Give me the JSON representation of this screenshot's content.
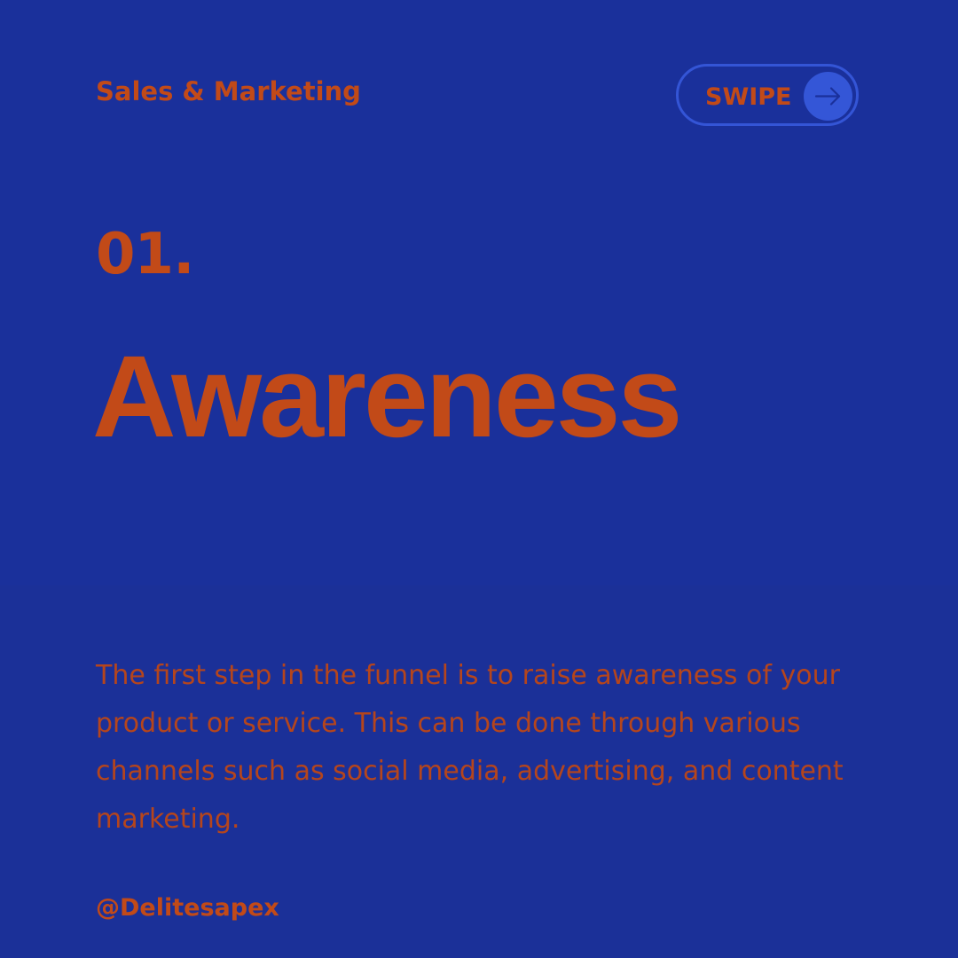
{
  "header": {
    "brand": "Sales & Marketing",
    "swipe_label": "SWIPE",
    "swipe_icon": "arrow-right-icon"
  },
  "step": {
    "number": "01.",
    "title": "Awareness"
  },
  "body": {
    "description": "The first step in the funnel is to raise awareness of your product or service. This can be done through various channels such as social media, advertising, and content marketing."
  },
  "footer": {
    "handle": "@Delitesapex"
  },
  "colors": {
    "background": "#1a309b",
    "accent_text": "#c24a18",
    "button_border": "#3455d6",
    "button_circle": "#3456d7"
  }
}
